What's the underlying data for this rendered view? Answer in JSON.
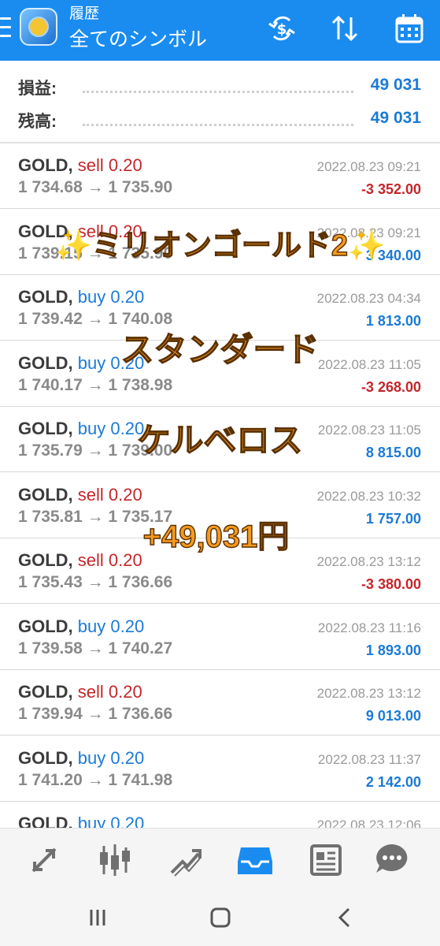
{
  "header": {
    "title_small": "履歴",
    "title": "全てのシンボル",
    "icons": [
      "menu-icon",
      "app-logo",
      "currency-exchange-icon",
      "sort-icon",
      "calendar-icon"
    ]
  },
  "summary": {
    "profit_label": "損益:",
    "profit_value": "49 031",
    "balance_label": "残高:",
    "balance_value": "49 031"
  },
  "trades": [
    {
      "symbol": "GOLD,",
      "type": "sell 0.20",
      "side": "sell",
      "prices": "1 734.68 → 1 735.90",
      "time": "2022.08.23 09:21",
      "pl": "-3 352.00"
    },
    {
      "symbol": "GOLD,",
      "type": "sell 0.20",
      "side": "sell",
      "prices": "1 739.15 → 1 735.90",
      "time": "2022.08.23 09:21",
      "pl": "3 340.00"
    },
    {
      "symbol": "GOLD,",
      "type": "buy 0.20",
      "side": "buy",
      "prices": "1 739.42 → 1 740.08",
      "time": "2022.08.23 04:34",
      "pl": "1 813.00"
    },
    {
      "symbol": "GOLD,",
      "type": "buy 0.20",
      "side": "buy",
      "prices": "1 740.17 → 1 738.98",
      "time": "2022.08.23 11:05",
      "pl": "-3 268.00"
    },
    {
      "symbol": "GOLD,",
      "type": "buy 0.20",
      "side": "buy",
      "prices": "1 735.79 → 1 739.00",
      "time": "2022.08.23 11:05",
      "pl": "8 815.00"
    },
    {
      "symbol": "GOLD,",
      "type": "sell 0.20",
      "side": "sell",
      "prices": "1 735.81 → 1 735.17",
      "time": "2022.08.23 10:32",
      "pl": "1 757.00"
    },
    {
      "symbol": "GOLD,",
      "type": "sell 0.20",
      "side": "sell",
      "prices": "1 735.43 → 1 736.66",
      "time": "2022.08.23 13:12",
      "pl": "-3 380.00"
    },
    {
      "symbol": "GOLD,",
      "type": "buy 0.20",
      "side": "buy",
      "prices": "1 739.58 → 1 740.27",
      "time": "2022.08.23 11:16",
      "pl": "1 893.00"
    },
    {
      "symbol": "GOLD,",
      "type": "sell 0.20",
      "side": "sell",
      "prices": "1 739.94 → 1 736.66",
      "time": "2022.08.23 13:12",
      "pl": "9 013.00"
    },
    {
      "symbol": "GOLD,",
      "type": "buy 0.20",
      "side": "buy",
      "prices": "1 741.20 → 1 741.98",
      "time": "2022.08.23 11:37",
      "pl": "2 142.00"
    },
    {
      "symbol": "GOLD,",
      "type": "buy 0.20",
      "side": "buy",
      "prices": "",
      "time": "2022.08.23 12:06",
      "pl": ""
    }
  ],
  "overlay": {
    "line1": "✨ミリオンゴールド2✨",
    "line2": "スタンダード",
    "line3": "ケルベロス",
    "line4": "+49,031円"
  },
  "bottom_nav": [
    "quotes-icon",
    "chart-icon",
    "trade-icon",
    "history-icon",
    "news-icon",
    "chat-icon"
  ],
  "colors": {
    "appbar": "#1a8cf0",
    "sell": "#c4262a",
    "buy": "#1b7ad6",
    "overlay": "#f59a1f"
  }
}
